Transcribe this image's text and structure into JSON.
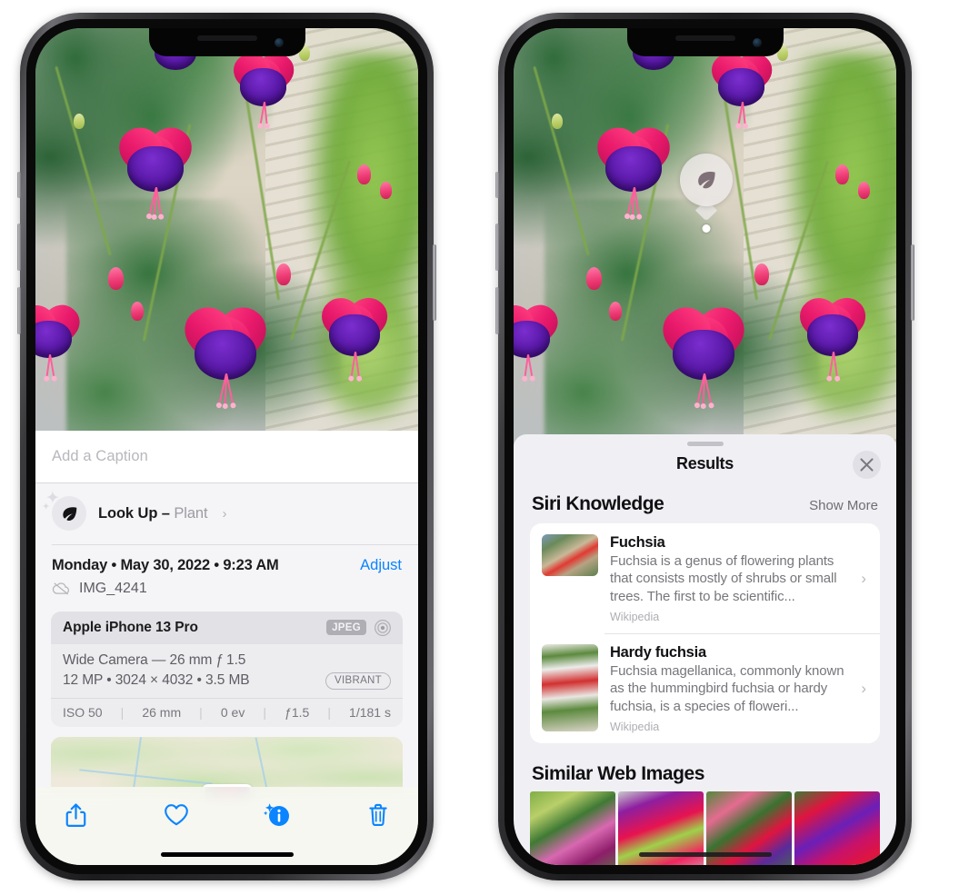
{
  "left_phone": {
    "caption": {
      "placeholder": "Add a Caption",
      "value": ""
    },
    "lookup": {
      "label": "Look Up",
      "dash": " – ",
      "subject": "Plant",
      "chevron": "›",
      "icon": "leaf-icon"
    },
    "meta": {
      "date": "Monday • May 30, 2022 • 9:23 AM",
      "adjust_label": "Adjust",
      "filename": "IMG_4241",
      "cloud_icon": "icloud-slash-icon"
    },
    "exif": {
      "device": "Apple iPhone 13 Pro",
      "format_badge": "JPEG",
      "lens_icon": "aperture-icon",
      "lens_line": "Wide Camera — 26 mm ƒ 1.5",
      "specs_line": "12 MP • 3024 × 4032 • 3.5 MB",
      "vibrant_badge": "VIBRANT",
      "shot": [
        {
          "label": "ISO 50"
        },
        {
          "label": "26 mm"
        },
        {
          "label": "0 ev"
        },
        {
          "label": "ƒ1.5"
        },
        {
          "label": "1/181 s"
        }
      ],
      "separator": "|"
    },
    "toolbar": [
      {
        "name": "share-icon",
        "label": "Share"
      },
      {
        "name": "heart-icon",
        "label": "Favorite"
      },
      {
        "name": "info-icon",
        "label": "Info"
      },
      {
        "name": "trash-icon",
        "label": "Delete"
      }
    ],
    "accent_color": "#0a84ff"
  },
  "right_phone": {
    "hotspot": {
      "icon": "leaf-icon"
    },
    "sheet": {
      "title": "Results",
      "close_icon": "close-icon",
      "sections": [
        {
          "title": "Siri Knowledge",
          "action": "Show More",
          "cards": [
            {
              "title": "Fuchsia",
              "desc": "Fuchsia is a genus of flowering plants that consists mostly of shrubs or small trees. The first to be scientific...",
              "source": "Wikipedia",
              "chevron": "›",
              "thumb": "fuchsia-red-thumb"
            },
            {
              "title": "Hardy fuchsia",
              "desc": "Fuchsia magellanica, commonly known as the hummingbird fuchsia or hardy fuchsia, is a species of floweri...",
              "source": "Wikipedia",
              "chevron": "›",
              "thumb": "hardy-fuchsia-thumb"
            }
          ]
        },
        {
          "title": "Similar Web Images",
          "action": "",
          "images": [
            {
              "name": "web-image-1"
            },
            {
              "name": "web-image-2"
            },
            {
              "name": "web-image-3"
            },
            {
              "name": "web-image-4"
            }
          ]
        }
      ]
    }
  }
}
